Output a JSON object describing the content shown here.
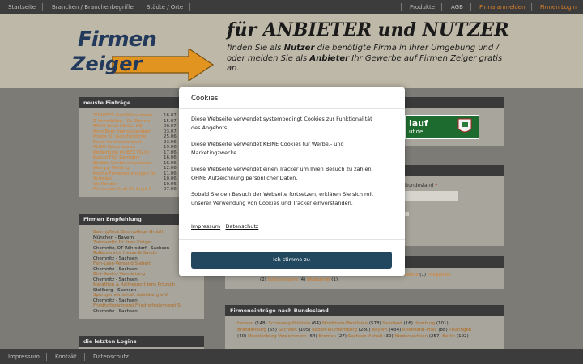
{
  "topnav": {
    "left": [
      "Startseite",
      "Branchen / Branchenbegriffe",
      "Städte / Orte"
    ],
    "right": [
      "Produkte",
      "AGB",
      "Firma anmelden",
      "Firmen Login"
    ]
  },
  "banner": {
    "logo_line1": "Firmen",
    "logo_line2": "Zeiger",
    "headline": "für ANBIETER und NUTZER",
    "sub_1": "finden Sie als ",
    "sub_nutzer": "Nutzer",
    "sub_2": " die benötigte Firma in Ihrer Umgebung und / oder melden Sie als ",
    "sub_anbieter": "Anbieter",
    "sub_3": " Ihr Gewerbe auf Firmen Zeiger gratis an."
  },
  "neueste": {
    "title": "neuste Einträge",
    "rows": [
      {
        "name": "TORUTEC GmbH Hannover",
        "date": "16.07."
      },
      {
        "name": "Z-Immobilien - Dr. Dennis",
        "date": "15.07."
      },
      {
        "name": "RACH GmbH & Co. KG",
        "date": "06.07."
      },
      {
        "name": "Arno Beer Immobilienberr",
        "date": "03.07."
      },
      {
        "name": "Praxis für Ganzheitliche",
        "date": "25.06."
      },
      {
        "name": "Feuer Schlüsseldienst",
        "date": "23.06."
      },
      {
        "name": "ALMO Hausmeister",
        "date": "19.06."
      },
      {
        "name": "Kinderkiste im BEZ FG Or",
        "date": "17.06."
      },
      {
        "name": "Kurum FSG Germany",
        "date": "16.06."
      },
      {
        "name": "Bindlos Containersysteme",
        "date": "16.06."
      },
      {
        "name": "Klempp Weiding",
        "date": "12.06."
      },
      {
        "name": "Mocha Ferienwohnungen Bo",
        "date": "11.06."
      },
      {
        "name": "Schwärz",
        "date": "10.06."
      },
      {
        "name": "Vis Render",
        "date": "10.06."
      },
      {
        "name": "Physio am Club 03 Amja S",
        "date": "07.06."
      }
    ]
  },
  "empfehlung": {
    "title": "Firmen Empfehlung",
    "rows": [
      {
        "name": "Baumpfleck Baumpflege GmbH",
        "loc": "München - Bayern"
      },
      {
        "name": "Zahnarztin Dr. Ines Krüger",
        "loc": "Chemnitz, OT Röhrsdorf - Sachsen"
      },
      {
        "name": "Rollerservice Hesse & Sande",
        "loc": "Chemnitz - Sachsen"
      },
      {
        "name": "Fein-Lese-Versand Siebert",
        "loc": "Chemnitz - Sachsen"
      },
      {
        "name": "Zini-Gastro Vermietung",
        "loc": "Chemnitz - Sachsen"
      },
      {
        "name": "Marathon & Rallyesport Jens Pritzsch",
        "loc": "Stollberg - Sachsen"
      },
      {
        "name": "Sportgemeinschaft Adelsberg e.V.",
        "loc": "Chemnitz - Sachsen"
      },
      {
        "name": "Friedhofsgärtnerei Friedhofsgärtnerei St",
        "loc": "Chemnitz - Sachsen"
      }
    ]
  },
  "logins": {
    "title": "die letzten Logins"
  },
  "right_panel_2": {
    "field_hint": "Bundesland",
    "required": "*"
  },
  "bundesland": {
    "top_line_pre": "(2)",
    "top_line_items": [
      {
        "name": "Schüttenberg",
        "count": "(4)"
      },
      {
        "name": "Wuppertal",
        "count": "(1)"
      }
    ],
    "top_right": "ssturz",
    "top_right_count": "(1)",
    "top_right_tail": "Pflegehein",
    "title": "Firmeneinträge nach Bundesland",
    "items": [
      {
        "name": "Hessen",
        "count": "(148)"
      },
      {
        "name": "Schleswig-Holstein",
        "count": "(64)"
      },
      {
        "name": "Nordrhein-Westfalen",
        "count": "(578)"
      },
      {
        "name": "Saarland",
        "count": "(16)"
      },
      {
        "name": "Hamburg",
        "count": "(101)"
      },
      {
        "name": "Brandenburg",
        "count": "(55)"
      },
      {
        "name": "Sachsen",
        "count": "(105)"
      },
      {
        "name": "Baden-Württemberg",
        "count": "(280)"
      },
      {
        "name": "Bayern",
        "count": "(434)"
      },
      {
        "name": "Rheinland-Pfalz",
        "count": "(88)"
      },
      {
        "name": "Thüringen",
        "count": "(40)"
      },
      {
        "name": "Mecklenburg-Vorpommern",
        "count": "(64)"
      },
      {
        "name": "Bremen",
        "count": "(27)"
      },
      {
        "name": "Sachsen-Anhalt",
        "count": "(30)"
      },
      {
        "name": "Niedersachsen",
        "count": "(257)"
      },
      {
        "name": "Berlin",
        "count": "(192)"
      }
    ]
  },
  "promo": {
    "text1": "lauf",
    "text2": "uf.de"
  },
  "modal": {
    "title": "Cookies",
    "p1": "Diese Webseite verwendet systembedingt Cookies zur Funktionalität des Angebots.",
    "p2": "Diese Webseite verwendet KEINE Cookies für Werbe.- und Marketingzwecke.",
    "p3": "Diese Webseite verwendet einen Tracker um Ihren Besuch zu zählen, OHNE Aufzeichnung persönlicher Daten.",
    "p4": "Sobald Sie den Besuch der Webseite fortsetzen, erklären Sie sich mit unserer Verwendung von Cookies und Tracker einverstanden.",
    "link_impressum": "Impressum",
    "link_sep": "|",
    "link_datenschutz": "Datenschutz",
    "button": "Ich stimme zu"
  },
  "footer": {
    "items": [
      "Impressum",
      "Kontakt",
      "Datenschutz"
    ]
  },
  "colors": {
    "accent": "#d9802a",
    "button": "#21485f",
    "navbar": "#3c3c3c",
    "banner": "#bdb8a7"
  }
}
